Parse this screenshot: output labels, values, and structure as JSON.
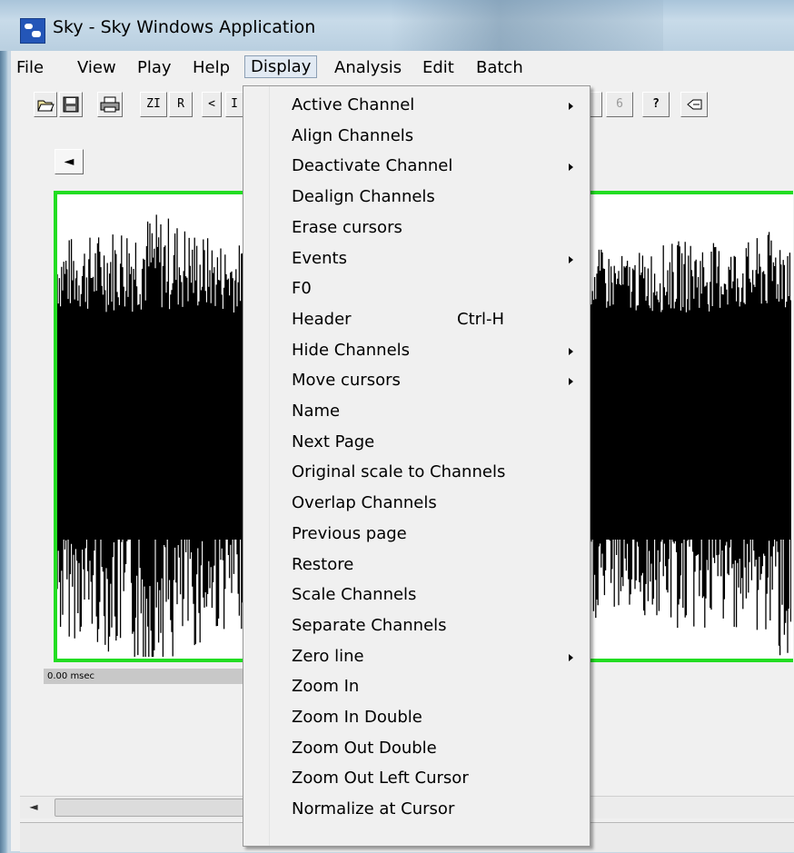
{
  "window": {
    "title": "Sky - Sky Windows Application"
  },
  "menubar": [
    "File",
    "View",
    "Play",
    "Help",
    "Display",
    "Analysis",
    "Edit",
    "Batch"
  ],
  "toolbar": {
    "zi_label": "ZI",
    "r_label": "R",
    "prev_label": "<",
    "partial_label": "I",
    "six_label": "6",
    "help_label": "?"
  },
  "icons": [
    "open-icon",
    "save-icon",
    "print-icon",
    "help-icon",
    "flag-icon",
    "app-icon"
  ],
  "client": {
    "time_label": "0.00 msec",
    "scroll_left": "◄"
  },
  "colors": {
    "wave_border": "#22dd22",
    "waveform": "#000000"
  },
  "display_menu": [
    {
      "label": "Active Channel",
      "submenu": true
    },
    {
      "label": "Align Channels"
    },
    {
      "label": "Deactivate Channel",
      "submenu": true
    },
    {
      "label": "Dealign Channels"
    },
    {
      "label": "Erase cursors"
    },
    {
      "label": "Events",
      "submenu": true
    },
    {
      "label": "F0"
    },
    {
      "label": "Header",
      "shortcut": "Ctrl-H"
    },
    {
      "label": "Hide Channels",
      "submenu": true
    },
    {
      "label": "Move cursors",
      "submenu": true
    },
    {
      "label": "Name"
    },
    {
      "label": "Next Page"
    },
    {
      "label": "Original scale to Channels"
    },
    {
      "label": "Overlap Channels"
    },
    {
      "label": "Previous page"
    },
    {
      "label": "Restore"
    },
    {
      "label": "Scale Channels"
    },
    {
      "label": "Separate Channels"
    },
    {
      "label": "Zero line",
      "submenu": true
    },
    {
      "label": "Zoom In"
    },
    {
      "label": "Zoom In Double"
    },
    {
      "label": "Zoom Out Double"
    },
    {
      "label": "Zoom Out Left Cursor"
    },
    {
      "label": "Normalize at Cursor"
    }
  ]
}
